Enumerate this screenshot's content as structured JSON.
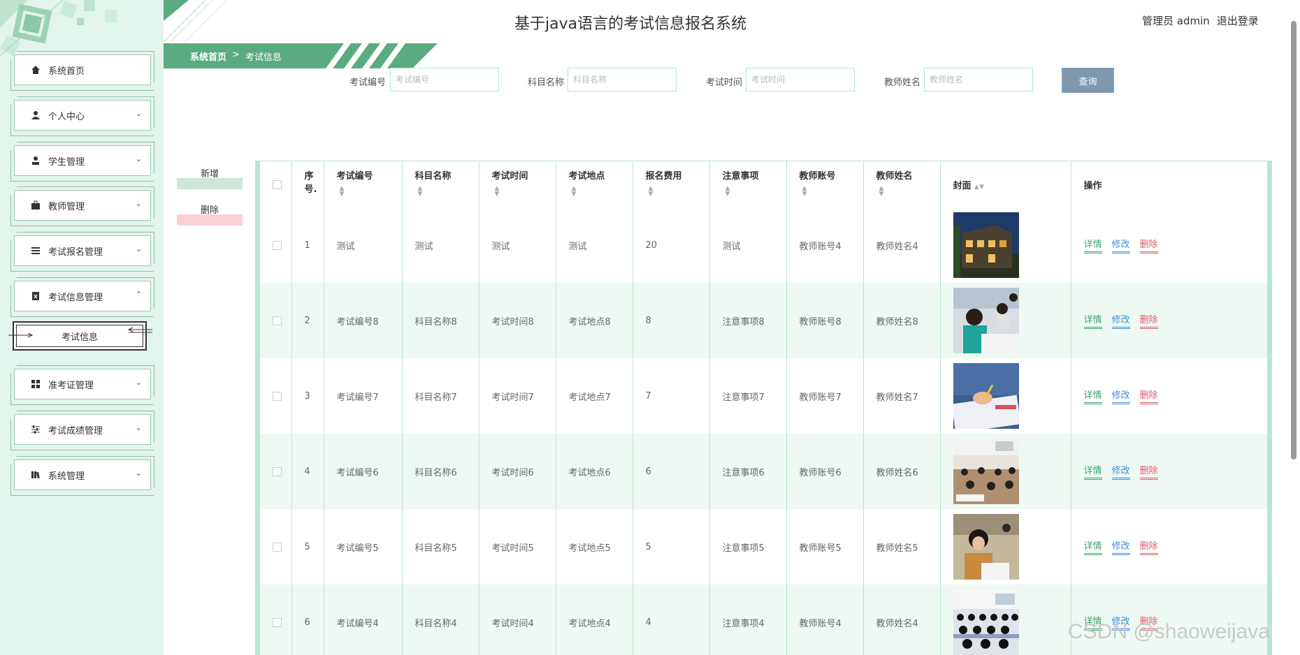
{
  "header": {
    "title": "基于java语言的考试信息报名系统",
    "user_label": "管理员 admin",
    "logout_label": "退出登录"
  },
  "breadcrumb": {
    "home": "系统首页",
    "separator": ">",
    "current": "考试信息"
  },
  "sidebar": {
    "items": [
      {
        "label": "系统首页",
        "icon": "home-icon"
      },
      {
        "label": "个人中心",
        "icon": "person-icon"
      },
      {
        "label": "学生管理",
        "icon": "student-icon"
      },
      {
        "label": "教师管理",
        "icon": "briefcase-icon"
      },
      {
        "label": "考试报名管理",
        "icon": "list-icon"
      },
      {
        "label": "考试信息管理",
        "icon": "document-x-icon"
      },
      {
        "label": "准考证管理",
        "icon": "grid-icon"
      },
      {
        "label": "考试成绩管理",
        "icon": "sliders-icon"
      },
      {
        "label": "系统管理",
        "icon": "book-icon"
      }
    ],
    "sub_item": {
      "label": "考试信息"
    }
  },
  "search": {
    "fields": [
      {
        "label": "考试编号",
        "placeholder": "考试编号",
        "value": ""
      },
      {
        "label": "科目名称",
        "placeholder": "科目名称",
        "value": ""
      },
      {
        "label": "考试时间",
        "placeholder": "考试时间",
        "value": ""
      },
      {
        "label": "教师姓名",
        "placeholder": "教师姓名",
        "value": ""
      }
    ],
    "button": "查询"
  },
  "actions": {
    "add": "新增",
    "delete": "删除"
  },
  "table": {
    "headers": [
      "序号.",
      "考试编号",
      "科目名称",
      "考试时间",
      "考试地点",
      "报名费用",
      "注意事项",
      "教师账号",
      "教师姓名",
      "封面",
      "操作"
    ],
    "rows": [
      {
        "index": "1",
        "exam_no": "测试",
        "subject": "测试",
        "time": "测试",
        "place": "测试",
        "fee": "20",
        "notice": "测试",
        "teacher_account": "教师账号4",
        "teacher_name": "教师姓名4",
        "cover": "building-photo"
      },
      {
        "index": "2",
        "exam_no": "考试编号8",
        "subject": "科目名称8",
        "time": "考试时间8",
        "place": "考试地点8",
        "fee": "8",
        "notice": "注意事项8",
        "teacher_account": "教师账号8",
        "teacher_name": "教师姓名8",
        "cover": "students-writing-photo"
      },
      {
        "index": "3",
        "exam_no": "考试编号7",
        "subject": "科目名称7",
        "time": "考试时间7",
        "place": "考试地点7",
        "fee": "7",
        "notice": "注意事项7",
        "teacher_account": "教师账号7",
        "teacher_name": "教师姓名7",
        "cover": "hand-writing-photo"
      },
      {
        "index": "4",
        "exam_no": "考试编号6",
        "subject": "科目名称6",
        "time": "考试时间6",
        "place": "考试地点6",
        "fee": "6",
        "notice": "注意事项6",
        "teacher_account": "教师账号6",
        "teacher_name": "教师姓名6",
        "cover": "exam-hall-photo"
      },
      {
        "index": "5",
        "exam_no": "考试编号5",
        "subject": "科目名称5",
        "time": "考试时间5",
        "place": "考试地点5",
        "fee": "5",
        "notice": "注意事项5",
        "teacher_account": "教师账号5",
        "teacher_name": "教师姓名5",
        "cover": "student-exam-photo"
      },
      {
        "index": "6",
        "exam_no": "考试编号4",
        "subject": "科目名称4",
        "time": "考试时间4",
        "place": "考试地点4",
        "fee": "4",
        "notice": "注意事项4",
        "teacher_account": "教师账号4",
        "teacher_name": "教师姓名4",
        "cover": "classroom-photo"
      }
    ],
    "ops": {
      "detail": "详情",
      "edit": "修改",
      "delete": "删除"
    }
  },
  "watermark": "CSDN @shaoweijava",
  "colors": {
    "accent": "#5aab82",
    "sidebar_bg": "#e3f4ec",
    "row_alt": "#eff9f4",
    "search_btn": "#7e98b0"
  }
}
